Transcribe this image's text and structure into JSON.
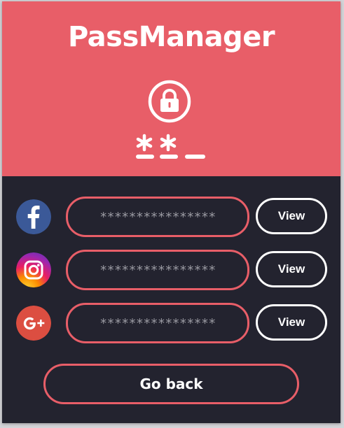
{
  "app": {
    "title": "PassManager"
  },
  "header": {
    "lock_icon": "padlock-circle-icon",
    "pin_icon": "password-asterisks-icon"
  },
  "accounts": [
    {
      "service_icon": "facebook-icon",
      "password_mask": "****************",
      "view_label": "View"
    },
    {
      "service_icon": "instagram-icon",
      "password_mask": "****************",
      "view_label": "View"
    },
    {
      "service_icon": "google-plus-icon",
      "password_mask": "****************",
      "view_label": "View"
    }
  ],
  "footer": {
    "back_label": "Go back"
  },
  "colors": {
    "accent": "#e85e68",
    "background": "#23232f",
    "text": "#ffffff",
    "mask_text": "#9a9aa2",
    "facebook": "#3b5998",
    "google_plus": "#dc4e41"
  }
}
